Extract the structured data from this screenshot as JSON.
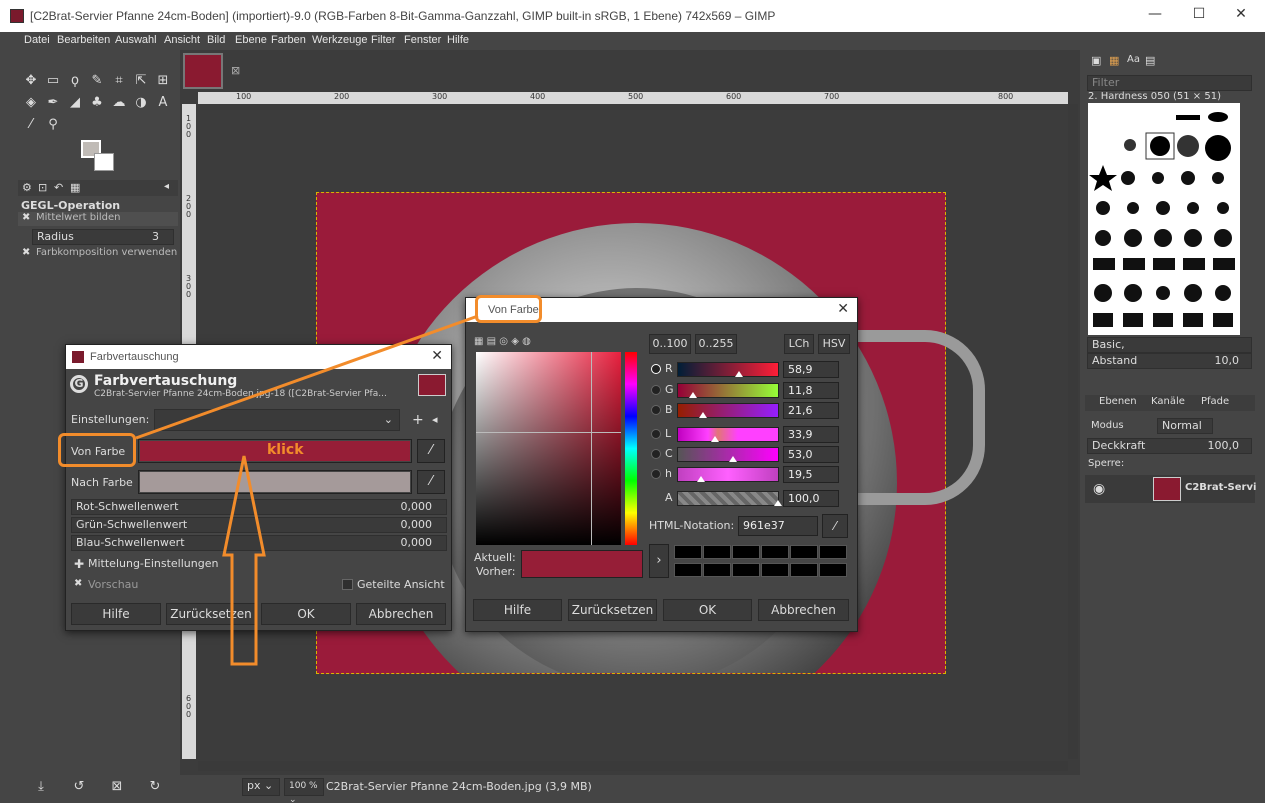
{
  "window": {
    "title": "[C2Brat-Servier Pfanne 24cm-Boden] (importiert)-9.0 (RGB-Farben 8-Bit-Gamma-Ganzzahl, GIMP built-in sRGB, 1 Ebene) 742x569 – GIMP",
    "min": "—",
    "max": "☐",
    "close": "✕"
  },
  "menu": [
    "Datei",
    "Bearbeiten",
    "Auswahl",
    "Ansicht",
    "Bild",
    "Ebene",
    "Farben",
    "Werkzeuge",
    "Filter",
    "Fenster",
    "Hilfe"
  ],
  "toolbox": {
    "gegl_title": "GEGL-Operation",
    "mean_label": "Mittelwert bilden",
    "radius_label": "Radius",
    "radius_value": "3",
    "compose_label": "Farbkomposition verwenden"
  },
  "ruler": {
    "h": [
      "100",
      "200",
      "300",
      "400",
      "500",
      "600",
      "700",
      "800"
    ],
    "v": [
      "1",
      "0",
      "0",
      "2",
      "0",
      "0",
      "3",
      "0",
      "0",
      "4",
      "0",
      "0",
      "5",
      "0",
      "0",
      "6",
      "0",
      "0"
    ]
  },
  "status": {
    "unit": "px",
    "zoom": "100 %",
    "file": "C2Brat-Servier Pfanne 24cm-Boden.jpg (3,9 MB)"
  },
  "right_panel": {
    "filter_placeholder": "Filter",
    "brush_name": "2. Hardness 050 (51 × 51)",
    "preset": "Basic,",
    "spacing_label": "Abstand",
    "spacing_value": "10,0",
    "tab_layers": "Ebenen",
    "tab_channels": "Kanäle",
    "tab_paths": "Pfade",
    "mode_label": "Modus",
    "mode_value": "Normal",
    "opacity_label": "Deckkraft",
    "opacity_value": "100,0",
    "lock_label": "Sperre:",
    "layer_name": "C2Brat-Servi"
  },
  "swap_dialog": {
    "window_title": "Farbvertauschung",
    "heading": "Farbvertauschung",
    "subheading": "C2Brat-Servier Pfanne 24cm-Boden.jpg-18 ([C2Brat-Servier Pfa...",
    "settings_label": "Einstellungen:",
    "from_label": "Von Farbe",
    "to_label": "Nach Farbe",
    "from_color": "#961e37",
    "to_color": "#a59a9a",
    "annotation": "klick",
    "red_label": "Rot-Schwellenwert",
    "red_value": "0,000",
    "green_label": "Grün-Schwellenwert",
    "green_value": "0,000",
    "blue_label": "Blau-Schwellenwert",
    "blue_value": "0,000",
    "blending_label": "Mittelung-Einstellungen",
    "preview_label": "Vorschau",
    "split_label": "Geteilte Ansicht",
    "help": "Hilfe",
    "reset": "Zurücksetzen",
    "ok": "OK",
    "cancel": "Abbrechen"
  },
  "color_dialog": {
    "window_title": "Von Farbe",
    "range_100": "0..100",
    "range_255": "0..255",
    "lch": "LCh",
    "hsv": "HSV",
    "channels": [
      {
        "name": "R",
        "value": "58,9",
        "fraction": 0.589
      },
      {
        "name": "G",
        "value": "11,8",
        "fraction": 0.118
      },
      {
        "name": "B",
        "value": "21,6",
        "fraction": 0.216
      },
      {
        "name": "L",
        "value": "33,9",
        "fraction": 0.339
      },
      {
        "name": "C",
        "value": "53,0",
        "fraction": 0.53
      },
      {
        "name": "h",
        "value": "19,5",
        "fraction": 0.195
      },
      {
        "name": "A",
        "value": "100,0",
        "fraction": 1.0
      }
    ],
    "html_label": "HTML-Notation:",
    "html_value": "961e37",
    "current_label": "Aktuell:",
    "previous_label": "Vorher:",
    "help": "Hilfe",
    "reset": "Zurücksetzen",
    "ok": "OK",
    "cancel": "Abbrechen"
  },
  "colors": {
    "accent_orange": "#f28c2b",
    "image_bg": "#9a1b3a",
    "window_teal": "#27a48f"
  }
}
